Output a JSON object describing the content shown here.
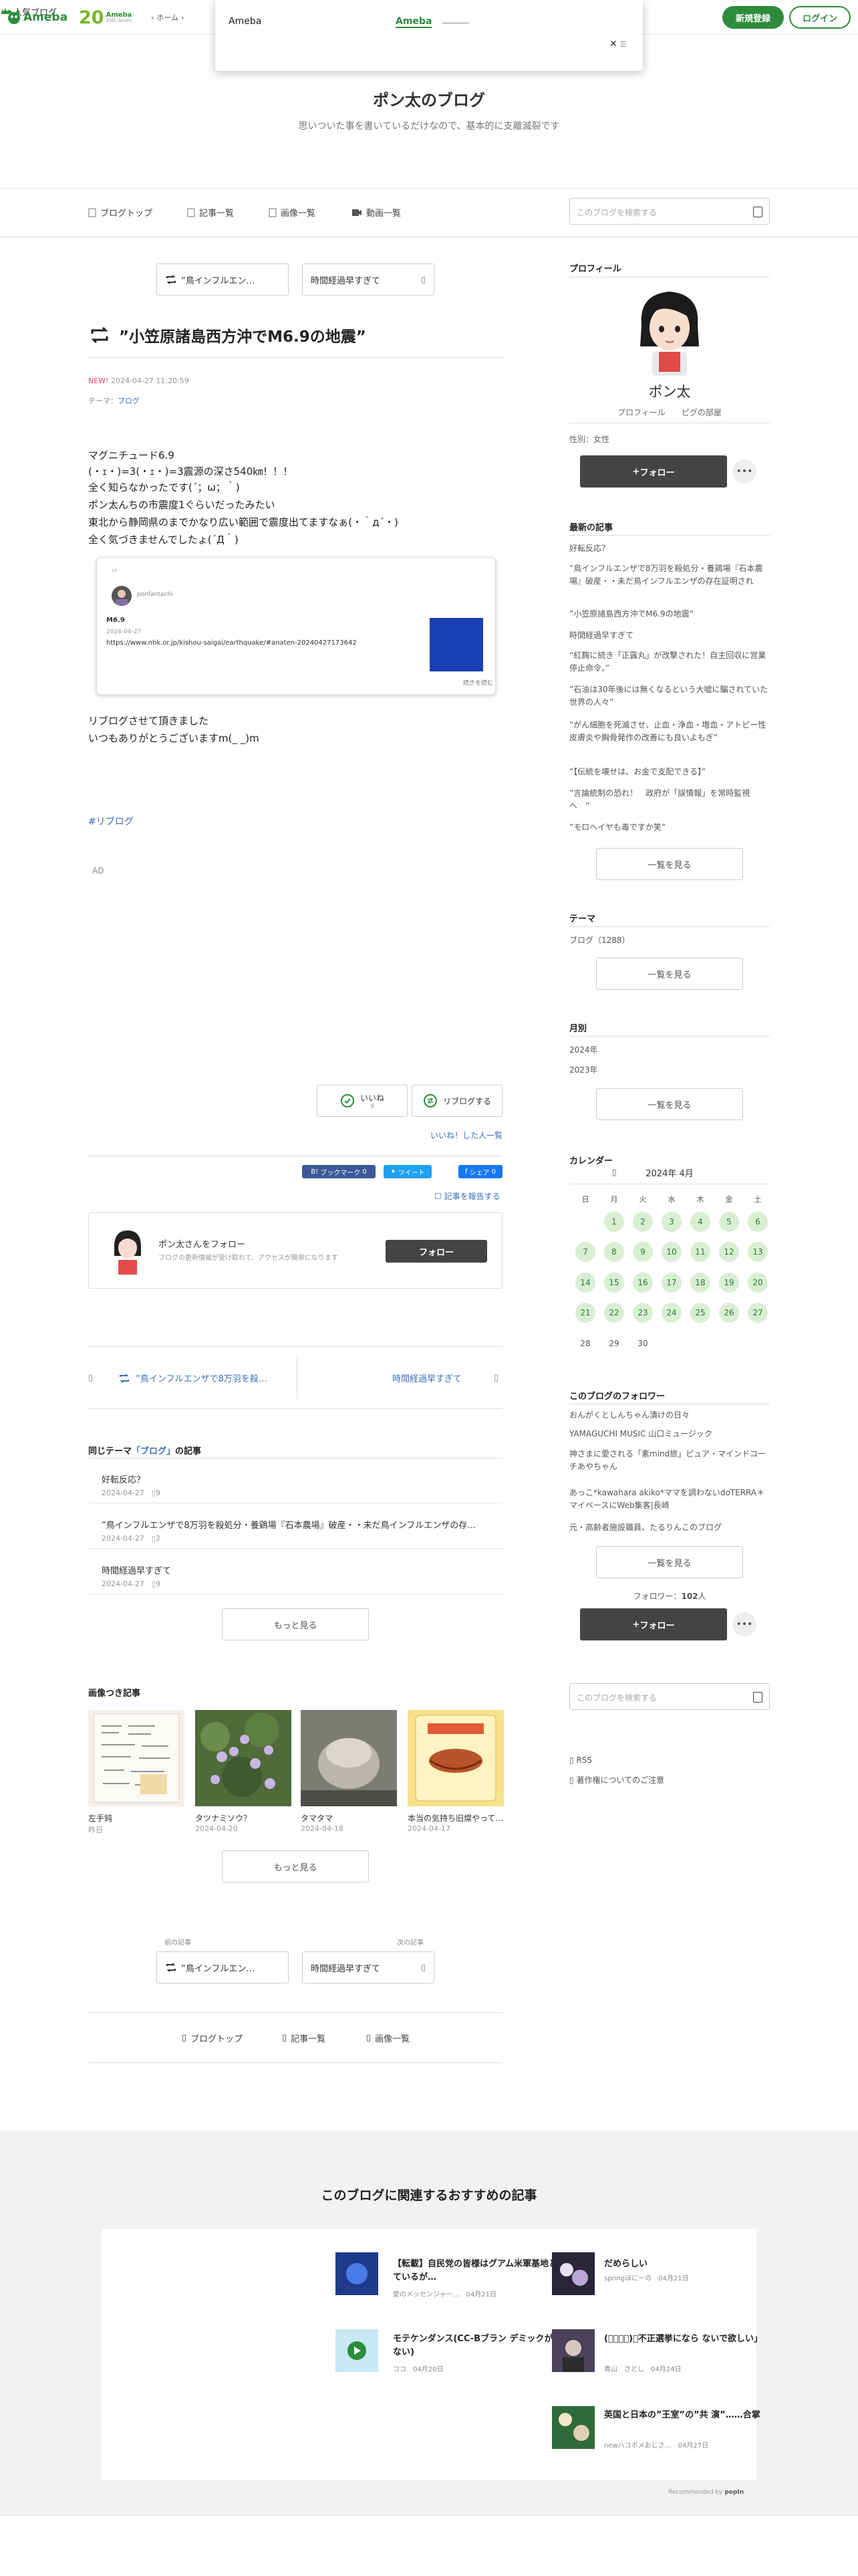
{
  "topbar": {
    "logo_text": "Ameba",
    "anniv_num": "20",
    "anniv_text": "Ameba",
    "anniv_sub": "20th Anniv.",
    "crumb_home": "ホーム",
    "popular_label": "人気ブログ",
    "signup_label": "新規登録",
    "login_label": "ログイン"
  },
  "popup": {
    "title": "Ameba",
    "link": "Ameba"
  },
  "blog": {
    "title": "ポン太のブログ",
    "description": "思いついた事を書いているだけなので、基本的に支離滅裂です"
  },
  "nav": {
    "top": "ブログトップ",
    "list": "記事一覧",
    "images": "画像一覧",
    "videos": "動画一覧",
    "search_placeholder": "このブログを検索する"
  },
  "entry_nav": {
    "prev_label": "”鳥インフルエン…",
    "next_label": "時間経過早すぎて",
    "prev_caption": "前の記事",
    "next_caption": "次の記事"
  },
  "entry": {
    "title": "”小笠原諸島西方沖でM6.9の地震”",
    "new_label": "NEW!",
    "datetime": "2024-04-27 11:20:59",
    "theme_prefix": "テーマ：",
    "theme": "ブログ",
    "lines": [
      "マグニチュード6.9",
      "(・ｪ・)=3(・ｪ・)=3震源の深さ540㎞！！！",
      "全く知らなかったです(´；ω；｀)",
      "ポン太んちの市震度1ぐらいだったみたい",
      "東北から静岡県のまでかなり広い範囲で震度出てますなぁ(・｀д´・)",
      "全く気づきませんでしたょ(´Д｀)"
    ],
    "embed": {
      "user": "ponfantachi",
      "headline": "M6.9",
      "date": "2024-04-27",
      "url": "https://www.nhk.or.jp/kishou-saigai/earthquake/#anaten-20240427173642",
      "more": "続きを読む"
    },
    "after_lines": [
      "リブログさせて頂きました",
      "いつもありがとうございますm(_ _)m"
    ],
    "hashtag": "#リブログ",
    "ad_label": "AD"
  },
  "actions": {
    "like_label": "いいね",
    "like_count": "9",
    "reblog_label": "リブログする",
    "liked_list": "いいね！した人一覧",
    "bookmark_label": "ブックマーク",
    "bookmark_count": "0",
    "tweet_label": "ツイート",
    "fb_label": "シェア",
    "fb_count": "0",
    "report_label": "記事を報告する"
  },
  "followbox": {
    "title": "ポン太さんをフォロー",
    "subtitle": "ブログの更新情報が受け取れて、アクセスが簡単になります",
    "button": "フォロー"
  },
  "pn_large": {
    "prev": "”鳥インフルエンザで8万羽を殺…",
    "next": "時間経過早すぎて"
  },
  "same_theme": {
    "prefix": "同じテーマ",
    "theme": "「ブログ」",
    "suffix": "の記事",
    "items": [
      {
        "title": "好転反応？",
        "date": "2024-04-27",
        "count": "9"
      },
      {
        "title": "”鳥インフルエンザで8万羽を殺処分・養鶏場『石本農場』破産・・未だ鳥インフルエンザの存…",
        "date": "2024-04-27",
        "count": "2"
      },
      {
        "title": "時間経過早すぎて",
        "date": "2024-04-27",
        "count": "9"
      }
    ],
    "more": "もっと見る"
  },
  "image_articles": {
    "title": "画像つき記事",
    "items": [
      {
        "caption": "左手鈍",
        "date": "昨日"
      },
      {
        "caption": "タツナミソウ？",
        "date": "2024-04-20"
      },
      {
        "caption": "タマタマ",
        "date": "2024-04-18"
      },
      {
        "caption": "本当の気持ち旧燦やって…",
        "date": "2024-04-17"
      }
    ],
    "more": "もっと見る"
  },
  "bottom_nav": {
    "top": "ブログトップ",
    "list": "記事一覧",
    "images": "画像一覧"
  },
  "sidebar": {
    "profile_heading": "プロフィール",
    "name": "ポン太",
    "profile_link": "プロフィール",
    "pigg_link": "ピグの部屋",
    "sex": "性別：女性",
    "follow": "フォロー",
    "recent_heading": "最新の記事",
    "recent": [
      "好転反応？",
      "”鳥インフルエンザで8万羽を殺処分・養鶏場『石本農場』破産・・未だ鳥インフルエンザの存在証明され",
      "”小笠原諸島西方沖でM6.9の地震”",
      "時間経過早すぎて",
      "”紅麹に続き「正露丸」が改撃された！自主回収に営業停止命令。”",
      "”石油は30年後には無くなるという大嘘に騙されていた世界の人々”",
      "”がん細胞を死滅させ、止血・浄血・増血・アトピー性皮膚炎や胸骨発作の改善にも良いよもぎ”",
      "”【伝統を壊せは、お金で支配できる】”",
      "”言論統制の恐れ！　政府が「誤情報」を常時監視へ　”",
      "”モロヘイヤも毒ですか笑”"
    ],
    "see_all": "一覧を見る",
    "theme_heading": "テーマ",
    "theme_item": "ブログ（1288）",
    "monthly_heading": "月別",
    "months": [
      "2024年",
      "2023年"
    ],
    "calendar_heading": "カレンダー",
    "cal_month": "2024年 4月",
    "dow": [
      "日",
      "月",
      "火",
      "水",
      "木",
      "金",
      "土"
    ],
    "followers_heading": "このブログのフォロワー",
    "followers": [
      "おんがくとしんちゃん漬けの日々",
      "YAMAGUCHI MUSIC 山口ミュージック",
      "神さまに愛される「素mind旅」ピュア・マインドコーチあやちゃん",
      "あっこ*kawahara akiko*ママを調わないdoTERRA＊マイベースにWeb集客|長崎",
      "元・高齢者施設職員、たるりんこのブログ"
    ],
    "follower_count_label": "フォロワー：",
    "follower_count": "102",
    "follower_unit": "人",
    "search_placeholder": "このブログを検索する",
    "rss": "RSS",
    "copyright": "著作権についてのご注意"
  },
  "recommend": {
    "title": "このブログに関連するおすすめの記事",
    "items": [
      {
        "title": "【転載】自民党の皆様はグアム米軍基地と書いているが…",
        "author": "愛のメッセンジャー…",
        "date": "04月21日"
      },
      {
        "title": "だめらしい",
        "author": "springほにーの",
        "date": "04月21日"
      },
      {
        "title": "モテケンダンス(CC-Bブラン デミックが止まらない)",
        "author": "ココ",
        "date": "04月20日"
      },
      {
        "title": "(ﾟーﾟ；)「不正選挙になら ないで欲しい」",
        "author": "青山　さとし",
        "date": "04月24日"
      },
      {
        "title": "英国と日本の”王室”の”共 演”……合掌",
        "author": "newハコボメおじさ…",
        "date": "04月27日"
      }
    ],
    "by_label": "Recommended by",
    "by_brand": "popIn"
  },
  "calendar_days": [
    {
      "d": "1",
      "on": true
    },
    {
      "d": "2",
      "on": true
    },
    {
      "d": "3",
      "on": true
    },
    {
      "d": "4",
      "on": true
    },
    {
      "d": "5",
      "on": true
    },
    {
      "d": "6",
      "on": true
    },
    {
      "d": "7",
      "on": true
    },
    {
      "d": "8",
      "on": true
    },
    {
      "d": "9",
      "on": true
    },
    {
      "d": "10",
      "on": true
    },
    {
      "d": "11",
      "on": true
    },
    {
      "d": "12",
      "on": true
    },
    {
      "d": "13",
      "on": true
    },
    {
      "d": "14",
      "on": true
    },
    {
      "d": "15",
      "on": true
    },
    {
      "d": "16",
      "on": true
    },
    {
      "d": "17",
      "on": true
    },
    {
      "d": "18",
      "on": true
    },
    {
      "d": "19",
      "on": true
    },
    {
      "d": "20",
      "on": true
    },
    {
      "d": "21",
      "on": true
    },
    {
      "d": "22",
      "on": true
    },
    {
      "d": "23",
      "on": true
    },
    {
      "d": "24",
      "on": true
    },
    {
      "d": "25",
      "on": true
    },
    {
      "d": "26",
      "on": true
    },
    {
      "d": "27",
      "on": true
    },
    {
      "d": "28",
      "on": false
    },
    {
      "d": "29",
      "on": false
    },
    {
      "d": "30",
      "on": false
    }
  ],
  "colors": {
    "brand_green": "#2d8c3c",
    "link_blue": "#3d6fb6",
    "new_pink": "#e8457a",
    "dark_button": "#444444",
    "calendar_day_bg": "#d9efd3"
  }
}
